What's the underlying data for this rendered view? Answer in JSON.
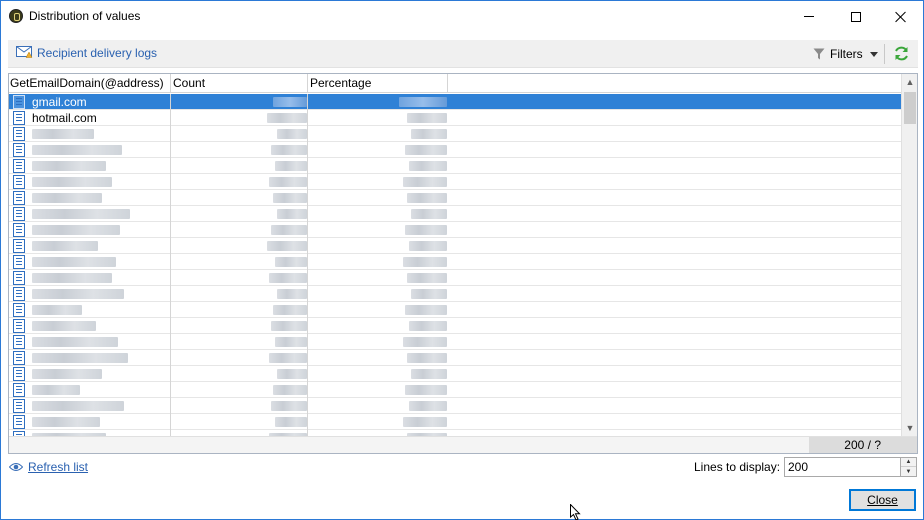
{
  "window": {
    "title": "Distribution of values"
  },
  "toolbar": {
    "link_label": "Recipient delivery logs",
    "filters_label": "Filters"
  },
  "grid": {
    "columns": [
      "GetEmailDomain(@address)",
      "Count",
      "Percentage"
    ],
    "rows": [
      {
        "domain": "gmail.com",
        "selected": true
      },
      {
        "domain": "hotmail.com",
        "selected": false
      },
      {
        "domain": "",
        "selected": false
      },
      {
        "domain": "",
        "selected": false
      },
      {
        "domain": "",
        "selected": false
      },
      {
        "domain": "",
        "selected": false
      },
      {
        "domain": "",
        "selected": false
      },
      {
        "domain": "",
        "selected": false
      },
      {
        "domain": "",
        "selected": false
      },
      {
        "domain": "",
        "selected": false
      },
      {
        "domain": "",
        "selected": false
      },
      {
        "domain": "",
        "selected": false
      },
      {
        "domain": "",
        "selected": false
      },
      {
        "domain": "",
        "selected": false
      },
      {
        "domain": "",
        "selected": false
      },
      {
        "domain": "",
        "selected": false
      },
      {
        "domain": "",
        "selected": false
      },
      {
        "domain": "",
        "selected": false
      },
      {
        "domain": "",
        "selected": false
      },
      {
        "domain": "",
        "selected": false
      },
      {
        "domain": "",
        "selected": false
      },
      {
        "domain": "",
        "selected": false
      }
    ],
    "count_display": "200 / ?"
  },
  "footer": {
    "refresh_label": "Refresh list",
    "lines_label": "Lines to display:",
    "lines_value": "200",
    "close_label": "Close"
  },
  "icons": {
    "app": "app-icon",
    "envelope": "envelope-icon",
    "filter": "filter-icon",
    "refresh": "refresh-icon",
    "row": "record-icon",
    "eye": "eye-icon"
  },
  "colors": {
    "selection": "#2f81d6",
    "link": "#2a61b0",
    "refresh_green": "#3aa63a",
    "window_border": "#2b79d6"
  }
}
